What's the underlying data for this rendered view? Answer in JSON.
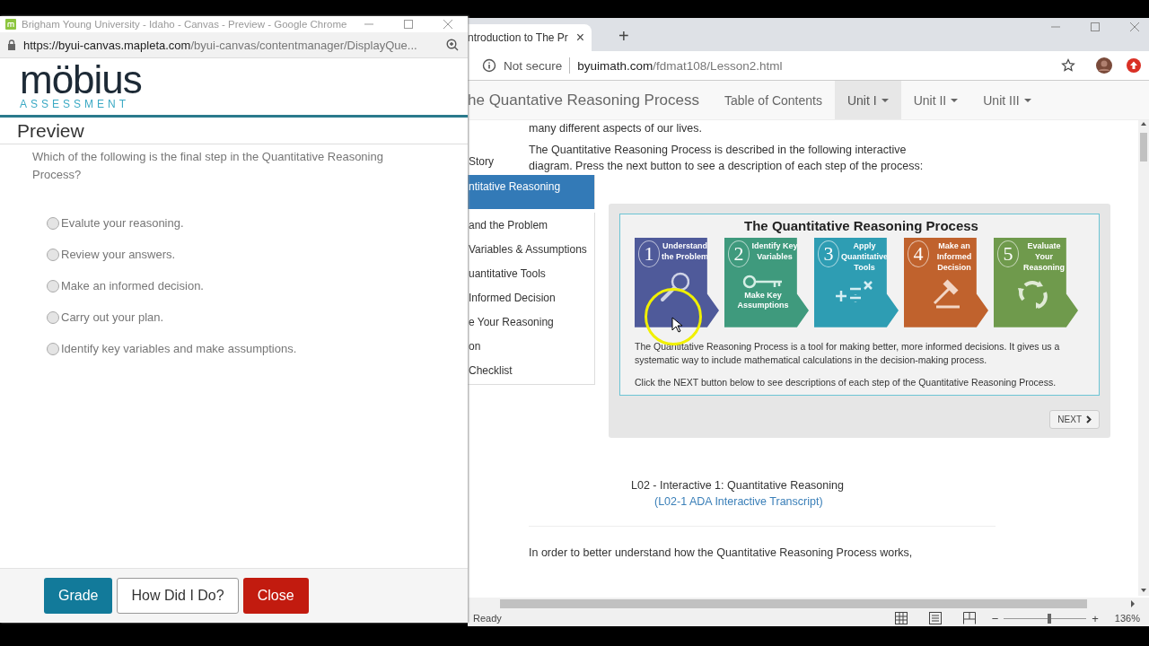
{
  "popup_window": {
    "title": "Brigham Young University - Idaho - Canvas - Preview - Google Chrome",
    "url_host": "https://byui-canvas.mapleta.com",
    "url_path": "/byui-canvas/contentmanager/DisplayQue...",
    "logo": {
      "word": "möbius",
      "tagline": "ASSESSMENT"
    },
    "heading": "Preview",
    "question": "Which of the following is the final step in the Quantitative Reasoning Process?",
    "options": [
      {
        "label": "Evalute your reasoning.",
        "selected": false
      },
      {
        "label": "Review your answers.",
        "selected": false
      },
      {
        "label": "Make an informed decision.",
        "selected": false
      },
      {
        "label": "Carry out your plan.",
        "selected": false
      },
      {
        "label": "Identify key variables and make assumptions.",
        "selected": false
      }
    ],
    "buttons": [
      {
        "label": "Grade",
        "kind": "primary"
      },
      {
        "label": "How Did I Do?",
        "kind": "default"
      },
      {
        "label": "Close",
        "kind": "danger"
      }
    ]
  },
  "browser_window": {
    "tab": {
      "title": "ntroduction to The Pr",
      "close": "×"
    },
    "new_tab": "+",
    "security": "Not secure",
    "url_host": "byuimath.com",
    "url_path": "/fdmat108/Lesson2.html",
    "navbar": {
      "brand": "he Quantative Reasoning Process",
      "items": [
        {
          "label": "Table of Contents",
          "dropdown": false,
          "selected": false
        },
        {
          "label": "Unit I",
          "dropdown": true,
          "selected": true
        },
        {
          "label": "Unit II",
          "dropdown": true,
          "selected": false
        },
        {
          "label": "Unit III",
          "dropdown": true,
          "selected": false
        }
      ]
    },
    "sidebar": [
      {
        "label": "Story",
        "selected": false
      },
      {
        "label": "ntitative Reasoning",
        "selected": true
      },
      {
        "label": "and the Problem",
        "selected": false
      },
      {
        "label": "Variables & Assumptions",
        "selected": false
      },
      {
        "label": "uantitative Tools",
        "selected": false
      },
      {
        "label": " Informed Decision",
        "selected": false
      },
      {
        "label": "e Your Reasoning",
        "selected": false
      },
      {
        "label": "on",
        "selected": false
      },
      {
        "label": "Checklist",
        "selected": false
      }
    ],
    "content": {
      "intro": "many different aspects of our lives.",
      "paragraph": "The Quantitative Reasoning Process is described in the following interactive diagram. Press the next button to see a description of each step of the process:",
      "interactive": {
        "title": "The Quantitative Reasoning Process",
        "steps": [
          {
            "number": "1",
            "label": "Understand the Problem",
            "kind": "magnifier",
            "color": "#4f5a9a"
          },
          {
            "number": "2",
            "label": "Identify Key Variables",
            "subtitle": "Make Key Assumptions",
            "kind": "key",
            "color": "#3f9a7d"
          },
          {
            "number": "3",
            "label": "Apply Quantitative Tools",
            "kind": "math",
            "color": "#2e9db3"
          },
          {
            "number": "4",
            "label": "Make an Informed Decision",
            "kind": "gavel",
            "color": "#c0622d"
          },
          {
            "number": "5",
            "label": "Evaluate Your Reasoning",
            "kind": "cycle",
            "color": "#6f9a4c"
          }
        ],
        "description": "The Quantitative Reasoning Process is a tool for making better, more informed decisions. It gives us a systematic way to include mathematical calculations in the decision-making process.",
        "instruction": "Click the NEXT button below to see descriptions of each step of the Quantitative Reasoning Process.",
        "next": "NEXT"
      },
      "caption": "L02 - Interactive 1: Quantitative Reasoning",
      "transcript_link": "(L02-1 ADA Interactive Transcript)",
      "bottom_paragraph": "In order to better understand how the Quantitative Reasoning Process works,"
    }
  },
  "status_bar": {
    "status": "Ready",
    "zoom_minus": "−",
    "zoom_plus": "+",
    "zoom": "136%",
    "level": 0.55
  }
}
